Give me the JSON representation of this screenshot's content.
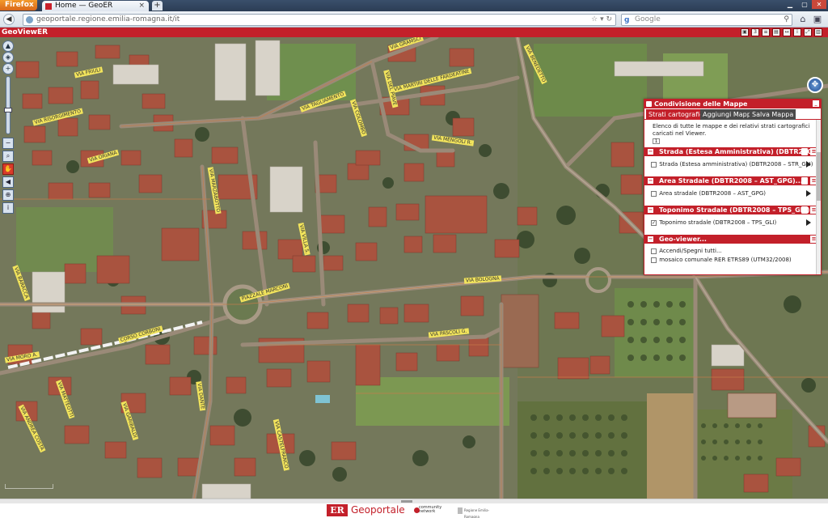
{
  "browser": {
    "app_button": "Firefox",
    "tab_title": "Home — GeoER",
    "new_tab": "+",
    "url": "geoportale.regione.emilia-romagna.it/it",
    "search_placeholder": "Google"
  },
  "app": {
    "title": "GeoViewER",
    "tool_icons": [
      "maximize-icon",
      "3d-view-icon",
      "layers-icon",
      "print-icon",
      "measure-icon",
      "info-icon",
      "fullscreen-icon",
      "legend-icon",
      "print2-icon",
      "save-icon"
    ]
  },
  "map": {
    "street_labels": [
      "VIA FRIULI",
      "VIA RISORGIMENTO",
      "VIA TAGLIAMENTO",
      "VIA MARTIRI DELLE FARDEATINE",
      "VIA BENEDETTO",
      "VIA GRAMSCI",
      "VIA DEL PIAVE",
      "VIA MENGOLI R.",
      "VIA MARZABOTTO",
      "VIA VILLA S.",
      "VIA BOLOGNA",
      "PIAZZALE MARCONI",
      "CORSO CORBONI",
      "VIA MORO A.",
      "VIA PASCOLI G.",
      "VIA MATTEOTTI",
      "VIA DANTE",
      "VIA BARACCA",
      "VIA GARIBALDI",
      "VIA ORIANA",
      "VIA CASTELFRANCO",
      "VIA ANDREA COSTA",
      "VIA COLOMBO"
    ]
  },
  "panel": {
    "title": "Condivisione delle Mappe",
    "tabs": [
      "Strati cartografici",
      "Aggiungi Mappa",
      "Salva Mappa"
    ],
    "description": "Elenco di tutte le mappe e dei relativi strati cartografici caricati nel Viewer.",
    "page": "1",
    "groups": [
      {
        "title": "Strada (Estesa Amministrativa) (DBTR2008",
        "layer": "Strada (Estesa amministrativa) (DBTR2008 – STR_GLI)",
        "checked": false
      },
      {
        "title": "Area Stradale (DBTR2008 – AST_GPG)...",
        "layer": "Area stradale (DBTR2008 – AST_GPG)",
        "checked": false
      },
      {
        "title": "Toponimo Stradale (DBTR2008 – TPS_GLI)",
        "layer": "Toponimo stradale (DBTR2008 – TPS_GLI)",
        "checked": true
      },
      {
        "title": "Geo-viewer...",
        "layer": "Accendi/Spegni tutti...",
        "sub": "mosaico comunale RER ETRS89 (UTM32/2008)",
        "checked": false
      }
    ]
  },
  "footer": {
    "logo_text": "ER",
    "brand": "Geoportale",
    "community": "community network",
    "region": "Regione Emilia-Romagna"
  },
  "colors": {
    "brand_red": "#c3202a",
    "tab_dark": "#4a4a4a"
  }
}
